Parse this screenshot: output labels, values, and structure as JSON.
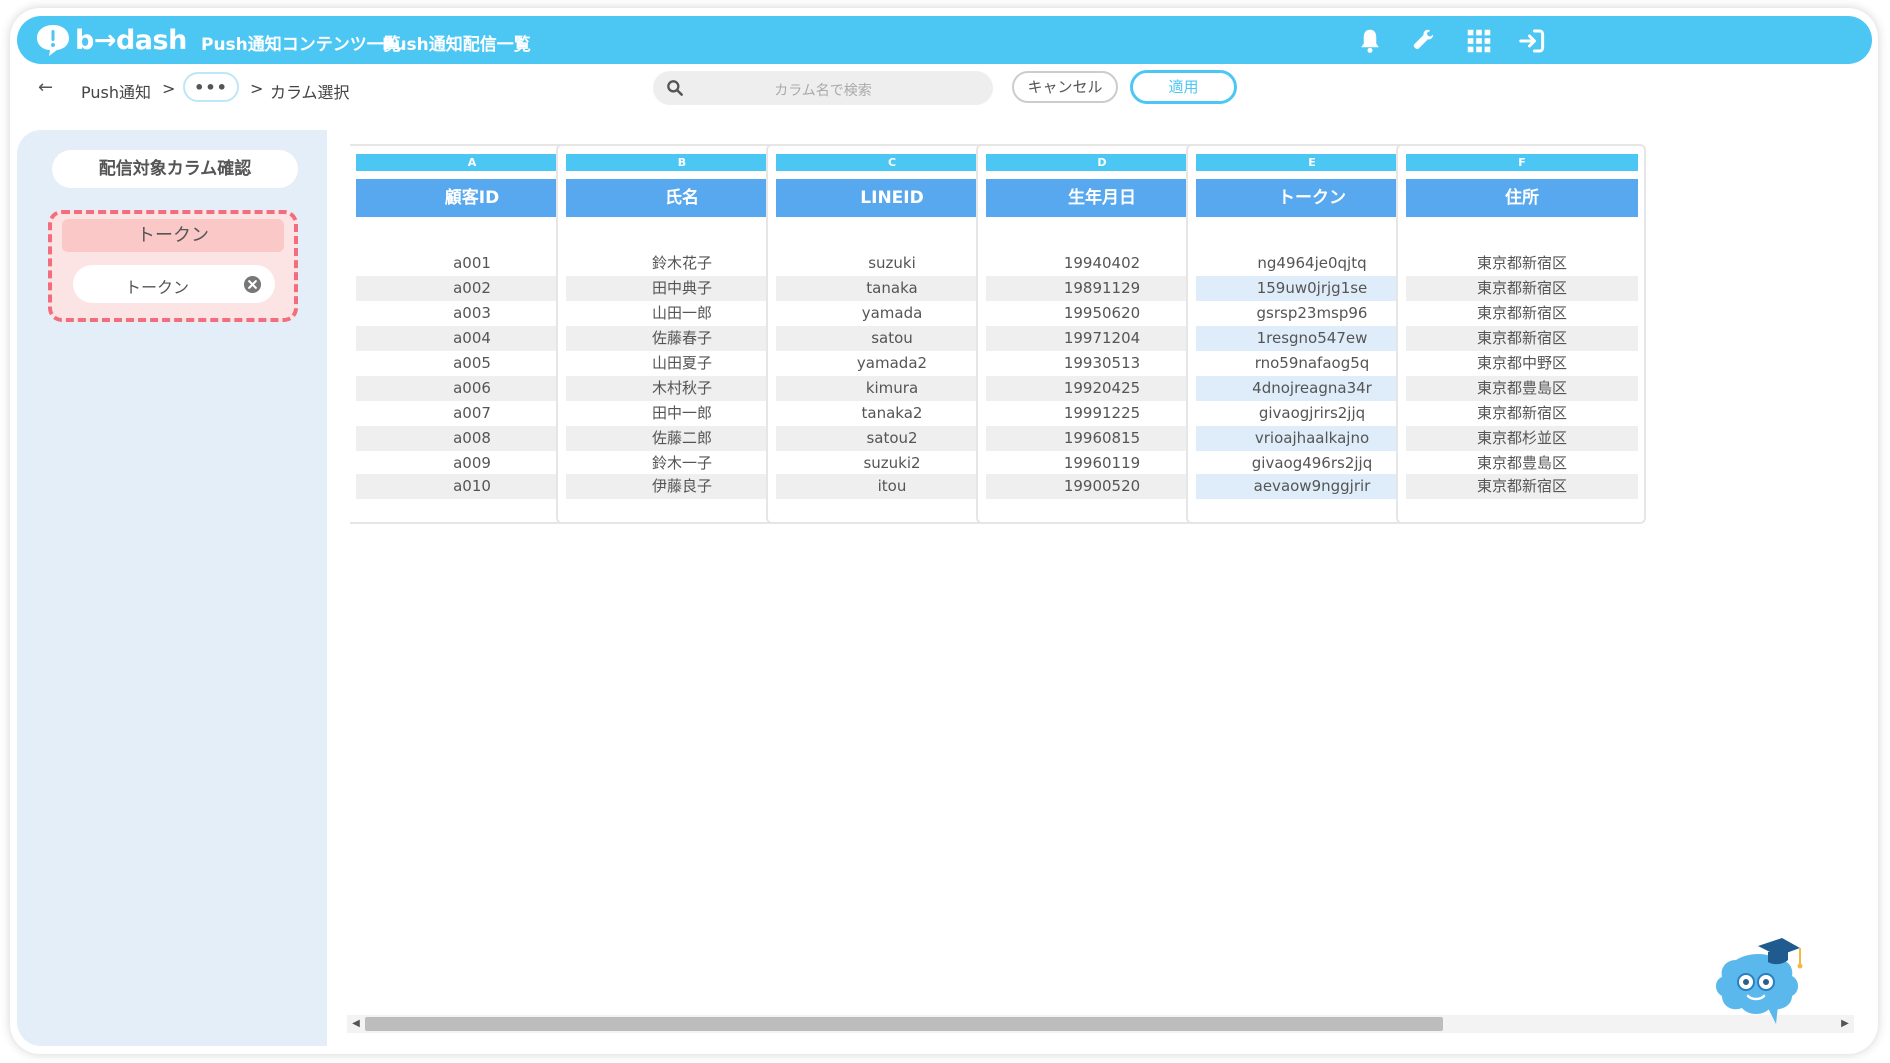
{
  "app": {
    "logo_text": "b→dash",
    "nav": [
      "Push通知コンテンツ一覧",
      "Push通知配信一覧"
    ]
  },
  "header_icons": [
    "bell-icon",
    "wrench-icon",
    "grid-icon",
    "logout-icon"
  ],
  "breadcrumb": {
    "back": "←",
    "root": "Push通知",
    "sep1": ">",
    "more": "•••",
    "sep2": ">",
    "current": "カラム選択"
  },
  "search": {
    "placeholder": "カラム名で検索"
  },
  "buttons": {
    "cancel": "キャンセル",
    "apply": "適用"
  },
  "sidebar": {
    "title": "配信対象カラム確認",
    "group_label": "トークン",
    "chip_label": "トークン"
  },
  "table": {
    "columns": [
      {
        "letter": "A",
        "name": "顧客ID",
        "values": [
          "a001",
          "a002",
          "a003",
          "a004",
          "a005",
          "a006",
          "a007",
          "a008",
          "a009",
          "a010"
        ],
        "selected": false
      },
      {
        "letter": "B",
        "name": "氏名",
        "values": [
          "鈴木花子",
          "田中典子",
          "山田一郎",
          "佐藤春子",
          "山田夏子",
          "木村秋子",
          "田中一郎",
          "佐藤二郎",
          "鈴木一子",
          "伊藤良子"
        ],
        "selected": false
      },
      {
        "letter": "C",
        "name": "LINEID",
        "values": [
          "suzuki",
          "tanaka",
          "yamada",
          "satou",
          "yamada2",
          "kimura",
          "tanaka2",
          "satou2",
          "suzuki2",
          "itou"
        ],
        "selected": false
      },
      {
        "letter": "D",
        "name": "生年月日",
        "values": [
          "19940402",
          "19891129",
          "19950620",
          "19971204",
          "19930513",
          "19920425",
          "19991225",
          "19960815",
          "19960119",
          "19900520"
        ],
        "selected": false
      },
      {
        "letter": "E",
        "name": "トークン",
        "values": [
          "ng4964je0qjtq",
          "159uw0jrjg1se",
          "gsrsp23msp96",
          "1resgno547ew",
          "rno59nafaog5q",
          "4dnojreagna34r",
          "givaogjrirs2jjq",
          "vrioajhaalkajno",
          "givaog496rs2jjq",
          "aevaow9nggjrir"
        ],
        "selected": true
      },
      {
        "letter": "F",
        "name": "住所",
        "values": [
          "東京都新宿区",
          "東京都新宿区",
          "東京都新宿区",
          "東京都新宿区",
          "東京都中野区",
          "東京都豊島区",
          "東京都新宿区",
          "東京都杉並区",
          "東京都豊島区",
          "東京都新宿区"
        ],
        "selected": false
      }
    ]
  },
  "scrollbar": {
    "left_arrow": "◀",
    "right_arrow": "▶",
    "position": 0.0
  },
  "colors": {
    "accent": "#4cc7f4",
    "column_header": "#57a8ee",
    "sidebar_bg": "#e3eef8",
    "highlight_border": "#f06e7d",
    "highlight_fill": "#fde4e4"
  }
}
